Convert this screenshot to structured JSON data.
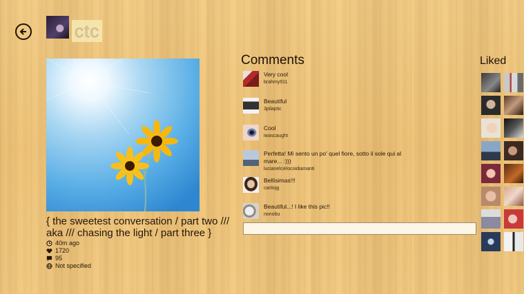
{
  "header": {
    "back_label": "Back",
    "username": "ctc"
  },
  "post": {
    "caption": "{ the sweetest conversation / part two /// aka /// chasing the light / part three }",
    "time": "40m ago",
    "likes": "1720",
    "comments_count": "95",
    "location": "Not specified"
  },
  "comments": {
    "title": "Comments",
    "items": [
      {
        "text": "Very cool",
        "author": "brahmy911"
      },
      {
        "text": "Beautiful",
        "author": "3pilaptic"
      },
      {
        "text": "Cool",
        "author": "iwascaught"
      },
      {
        "text": "Perfetta! Mi sento un po' quel fiore, sotto il sole qui al mare... :)))",
        "author": "lucianelcielocoidiamanti"
      },
      {
        "text": "Bellísimas!!!",
        "author": "caritojg"
      },
      {
        "text": "Beautiful...! I like this pic!!",
        "author": "nonobu"
      }
    ],
    "input_placeholder": ""
  },
  "liked": {
    "title": "Liked",
    "count_shown": 16
  },
  "colors": {
    "background": "#efc47a",
    "text": "#241608",
    "input_bg": "#fcf6e6"
  }
}
